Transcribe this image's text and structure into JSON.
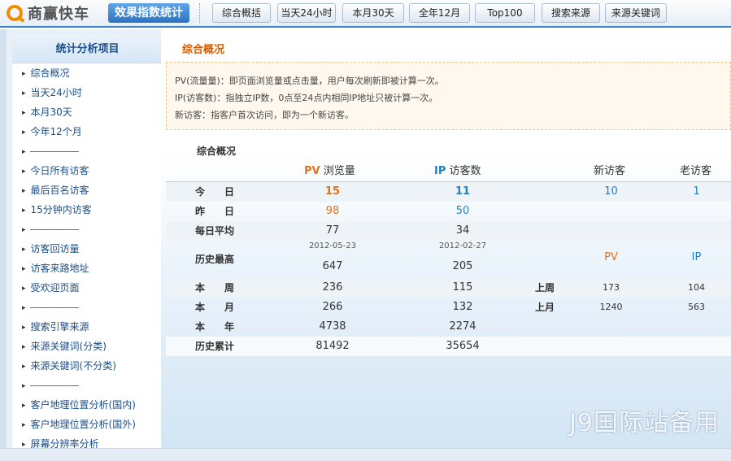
{
  "header": {
    "logo_text": "商赢快车",
    "product_tag": "效果指数统计",
    "nav": [
      "综合概括",
      "当天24小时",
      "本月30天",
      "全年12月",
      "Top100",
      "搜索来源",
      "来源关键词"
    ]
  },
  "sidebar": {
    "title": "统计分析项目",
    "items": [
      "综合概况",
      "当天24小时",
      "本月30天",
      "今年12个月",
      "------------------",
      "今日所有访客",
      "最后百名访客",
      "15分钟内访客",
      "------------------",
      "访客回访量",
      "访客来路地址",
      "受欢迎页面",
      "------------------",
      "搜索引擎来源",
      "来源关键词(分类)",
      "来源关键词(不分类)",
      "------------------",
      "客户地理位置分析(国内)",
      "客户地理位置分析(国外)",
      "屏幕分辨率分析"
    ]
  },
  "main": {
    "section_title": "综合概况",
    "info": [
      "PV(流量量)：即页面浏览量或点击量，用户每次刷新即被计算一次。",
      "IP(访客数)：指独立IP数，0点至24点内相同IP地址只被计算一次。",
      "新访客：指客户首次访问，即为一个新访客。"
    ],
    "overview_label": "综合概况",
    "headers": {
      "pv_key": "PV",
      "pv_text": "浏览量",
      "ip_key": "IP",
      "ip_text": "访客数",
      "new_visitors": "新访客",
      "old_visitors": "老访客"
    },
    "rows": {
      "today": {
        "label": "今　　日",
        "pv": "15",
        "ip": "11",
        "new": "10",
        "old": "1"
      },
      "yesterday": {
        "label": "昨　　日",
        "pv": "98",
        "ip": "50"
      },
      "daily_avg": {
        "label": "每日平均",
        "pv": "77",
        "ip": "34"
      },
      "history_max": {
        "label": "历史最高",
        "pv_date": "2012-05-23",
        "ip_date": "2012-02-27",
        "pv": "647",
        "ip": "205",
        "sub_pv": "PV",
        "sub_ip": "IP"
      },
      "this_week": {
        "label": "本　　周",
        "pv": "236",
        "ip": "115",
        "cmp_label": "上周",
        "cmp_pv": "173",
        "cmp_ip": "104"
      },
      "this_month": {
        "label": "本　　月",
        "pv": "266",
        "ip": "132",
        "cmp_label": "上月",
        "cmp_pv": "1240",
        "cmp_ip": "563"
      },
      "this_year": {
        "label": "本　　年",
        "pv": "4738",
        "ip": "2274"
      },
      "total": {
        "label": "历史累计",
        "pv": "81492",
        "ip": "35654"
      }
    }
  },
  "watermark": "J9国际站备用",
  "colors": {
    "accent_orange": "#e0721b",
    "accent_blue": "#1f7fc3",
    "brand_blue": "#2b73c3"
  }
}
